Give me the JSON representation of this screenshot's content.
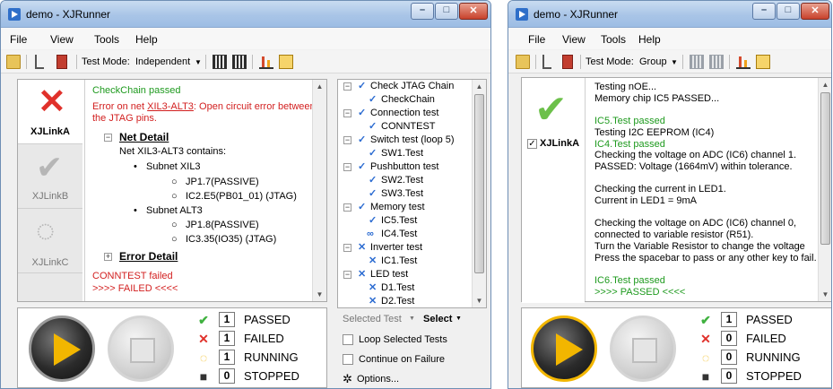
{
  "colors": {
    "pass": "#1e9a1e",
    "fail": "#d21f1f",
    "accent": "#f2b600"
  },
  "left": {
    "title": "demo - XJRunner",
    "menu": [
      "File",
      "View",
      "Tools",
      "Help"
    ],
    "toolbar": {
      "mode_label": "Test Mode:",
      "mode_value": "Independent"
    },
    "links": [
      "XJLinkA",
      "XJLinkB",
      "XJLinkC"
    ],
    "log": {
      "line1": "CheckChain passed",
      "error1": "Error on net ",
      "error1_link": "XIL3-ALT3",
      "error1_rest": ": Open circuit error between",
      "error2": "the JTAG pins.",
      "net_detail": "Net Detail",
      "net_contains": "Net XIL3-ALT3 contains:",
      "subnet1": "Subnet XIL3",
      "subnet1_item1": "JP1.7(PASSIVE)",
      "subnet1_item2": "IC2.E5(PB01_01) (JTAG)",
      "subnet2": "Subnet ALT3",
      "subnet2_item1": "JP1.8(PASSIVE)",
      "subnet2_item2": "IC3.35(IO35) (JTAG)",
      "error_detail": "Error Detail",
      "failed1": "CONNTEST failed",
      "failed2": ">>>> FAILED <<<<"
    },
    "tree": [
      "Check JTAG Chain",
      "CheckChain",
      "Connection test",
      "CONNTEST",
      "Switch test (loop 5)",
      "SW1.Test",
      "Pushbutton test",
      "SW2.Test",
      "SW3.Test",
      "Memory test",
      "IC5.Test",
      "IC4.Test",
      "Inverter test",
      "IC1.Test",
      "LED test",
      "D1.Test",
      "D2.Test"
    ],
    "options": {
      "selected_test": "Selected Test",
      "select": "Select",
      "loop": "Loop Selected Tests",
      "continue": "Continue on Failure",
      "options": "Options..."
    },
    "stats": [
      {
        "count": "1",
        "label": "PASSED"
      },
      {
        "count": "1",
        "label": "FAILED"
      },
      {
        "count": "1",
        "label": "RUNNING"
      },
      {
        "count": "0",
        "label": "STOPPED"
      }
    ]
  },
  "right": {
    "title": "demo - XJRunner",
    "menu": [
      "File",
      "View",
      "Tools",
      "Help"
    ],
    "toolbar": {
      "mode_label": "Test Mode:",
      "mode_value": "Group"
    },
    "link": "XJLinkA",
    "log": [
      {
        "text": "Testing nOE...",
        "c": "k"
      },
      {
        "text": "Memory chip IC5 PASSED...",
        "c": "k"
      },
      {
        "text": "",
        "c": "k"
      },
      {
        "text": "IC5.Test passed",
        "c": "g"
      },
      {
        "text": "Testing I2C EEPROM (IC4)",
        "c": "k"
      },
      {
        "text": "IC4.Test passed",
        "c": "g"
      },
      {
        "text": "Checking the voltage on ADC (IC6) channel 1.",
        "c": "k"
      },
      {
        "text": "PASSED: Voltage (1664mV) within tolerance.",
        "c": "k"
      },
      {
        "text": "",
        "c": "k"
      },
      {
        "text": "Checking the current in LED1.",
        "c": "k"
      },
      {
        "text": "Current in LED1 = 9mA",
        "c": "k"
      },
      {
        "text": "",
        "c": "k"
      },
      {
        "text": "Checking the voltage on ADC (IC6) channel 0,",
        "c": "k"
      },
      {
        "text": "connected to variable resistor (R51).",
        "c": "k"
      },
      {
        "text": "Turn the Variable Resistor to change the voltage",
        "c": "k"
      },
      {
        "text": "Press the spacebar to pass or any other key to fail.",
        "c": "k"
      },
      {
        "text": "",
        "c": "k"
      },
      {
        "text": "IC6.Test passed",
        "c": "g"
      },
      {
        "text": ">>>> PASSED <<<<",
        "c": "g"
      }
    ],
    "stats": [
      {
        "count": "1",
        "label": "PASSED"
      },
      {
        "count": "0",
        "label": "FAILED"
      },
      {
        "count": "0",
        "label": "RUNNING"
      },
      {
        "count": "0",
        "label": "STOPPED"
      }
    ]
  }
}
